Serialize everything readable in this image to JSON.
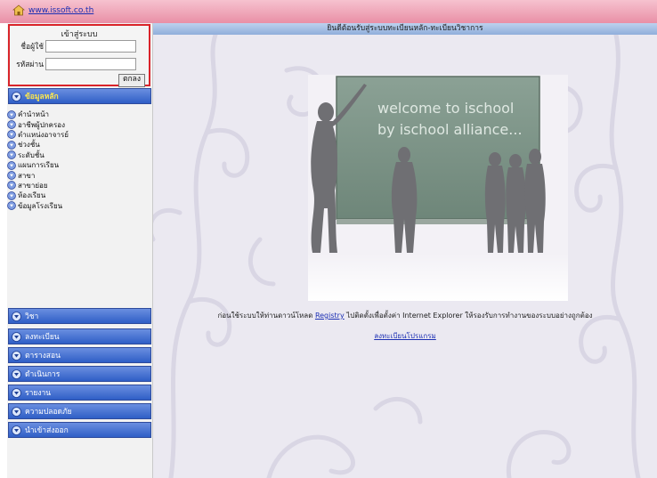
{
  "header": {
    "home_link": "www.issoft.co.th"
  },
  "login": {
    "title": "เข้าสู่ระบบ",
    "username_label": "ชื่อผู้ใช้",
    "password_label": "รหัสผ่าน",
    "username_value": "",
    "password_value": "",
    "submit_label": "ตกลง"
  },
  "sidebar": {
    "main_section": "ข้อมูลหลัก",
    "items": [
      "คำนำหน้า",
      "อาชีพผู้ปกครอง",
      "ตำแหน่งอาจารย์",
      "ช่วงชั้น",
      "ระดับชั้น",
      "แผนการเรียน",
      "สาขา",
      "สาขาย่อย",
      "ห้องเรียน",
      "ข้อมูลโรงเรียน"
    ],
    "sections": [
      "วิชา",
      "ลงทะเบียน",
      "ตารางสอน",
      "ดำเนินการ",
      "รายงาน",
      "ความปลอดภัย",
      "นำเข้าส่งออก"
    ]
  },
  "main": {
    "welcome_title": "ยินดีต้อนรับสู่ระบบทะเบียนหลัก-ทะเบียนวิชาการ",
    "board_line1": "welcome to ischool",
    "board_line2": "by ischool alliance...",
    "note_before": "ก่อนใช้ระบบให้ท่านดาวน์โหลด ",
    "note_link": "Registry",
    "note_after": " ไปติดตั้งเพื่อตั้งค่า Internet Explorer ให้รองรับการทำงานของระบบอย่างถูกต้อง",
    "register_link": "ลงทะเบียนโปรแกรม"
  },
  "colors": {
    "accent_red": "#d9242a",
    "nav_blue": "#2f5ec6",
    "header_pink": "#e98fa6",
    "board_green": "#7d9688"
  }
}
